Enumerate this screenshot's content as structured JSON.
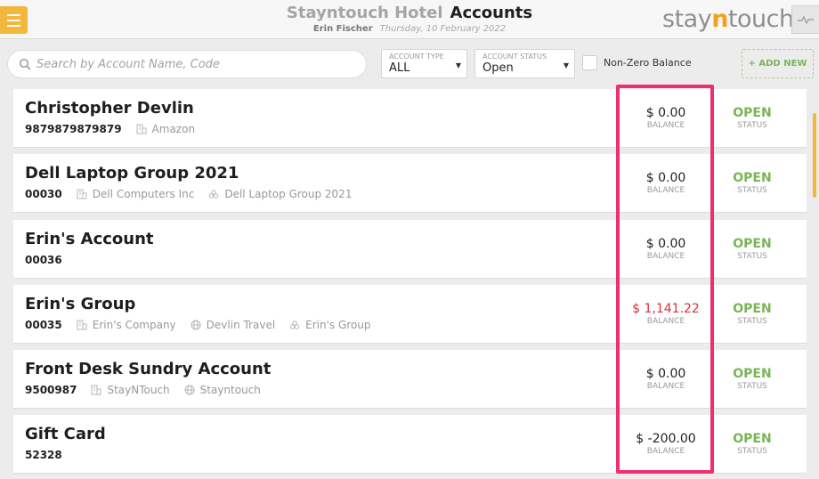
{
  "header": {
    "hotel_name": "Stayntouch Hotel",
    "page_title": "Accounts",
    "user_name": "Erin Fischer",
    "date": "Thursday, 10 February 2022",
    "brand_left": "stay",
    "brand_accent": "n",
    "brand_right": "touch"
  },
  "filters": {
    "search_placeholder": "Search by Account Name, Code",
    "account_type": {
      "label": "ACCOUNT TYPE",
      "value": "ALL"
    },
    "account_status": {
      "label": "ACCOUNT STATUS",
      "value": "Open"
    },
    "non_zero_label": "Non-Zero Balance",
    "add_new_label": "+ ADD NEW"
  },
  "colors": {
    "accent": "#f3b73b",
    "status_open": "#78b556",
    "negative_balance": "#d8333a",
    "highlight": "#f0306d"
  },
  "accounts": [
    {
      "name": "Christopher Devlin",
      "number": "9879879879879",
      "company": "Amazon",
      "travel_agent": null,
      "group": null,
      "balance": "$ 0.00",
      "balance_label": "BALANCE",
      "status": "OPEN",
      "status_label": "STATUS"
    },
    {
      "name": "Dell Laptop Group 2021",
      "number": "00030",
      "company": "Dell Computers Inc",
      "travel_agent": null,
      "group": "Dell Laptop Group 2021",
      "balance": "$ 0.00",
      "balance_label": "BALANCE",
      "status": "OPEN",
      "status_label": "STATUS"
    },
    {
      "name": "Erin's Account",
      "number": "00036",
      "company": null,
      "travel_agent": null,
      "group": null,
      "balance": "$ 0.00",
      "balance_label": "BALANCE",
      "status": "OPEN",
      "status_label": "STATUS"
    },
    {
      "name": "Erin's Group",
      "number": "00035",
      "company": "Erin's Company",
      "travel_agent": "Devlin Travel",
      "group": "Erin's Group",
      "balance": "$ 1,141.22",
      "balance_label": "BALANCE",
      "status": "OPEN",
      "status_label": "STATUS"
    },
    {
      "name": "Front Desk Sundry Account",
      "number": "9500987",
      "company": "StayNTouch",
      "travel_agent": "Stayntouch",
      "group": null,
      "balance": "$ 0.00",
      "balance_label": "BALANCE",
      "status": "OPEN",
      "status_label": "STATUS"
    },
    {
      "name": "Gift Card",
      "number": "52328",
      "company": null,
      "travel_agent": null,
      "group": null,
      "balance": "$ -200.00",
      "balance_label": "BALANCE",
      "status": "OPEN",
      "status_label": "STATUS"
    }
  ]
}
